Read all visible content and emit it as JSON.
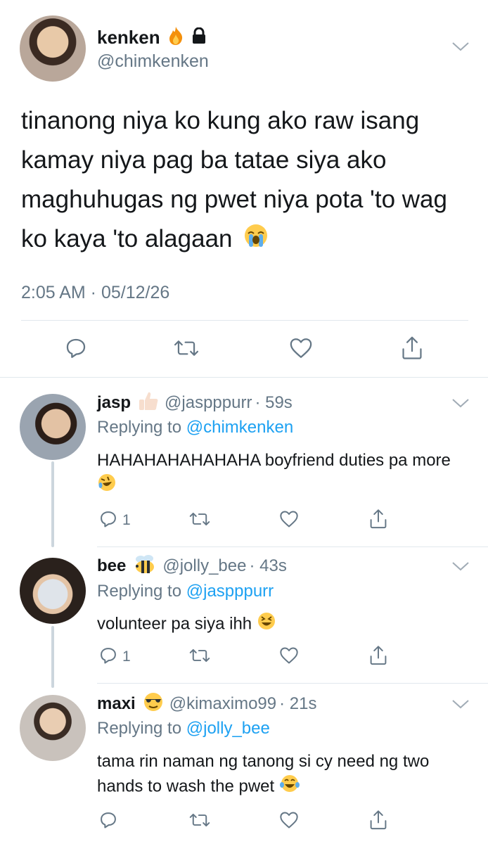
{
  "main_tweet": {
    "display_name": "kenken",
    "handle": "@chimkenken",
    "text": "tinanong niya ko kung ako raw isang kamay niya pag ba tatae siya ako maghuhugas ng pwet niya pota 'to wag ko kaya 'to alagaan",
    "timestamp": "2:05 AM · 05/12/26",
    "name_emojis": [
      "fire-emoji",
      "lock-icon"
    ],
    "text_emoji": "loudly-crying-emoji"
  },
  "replies": [
    {
      "display_name": "jasp",
      "name_emoji": "thumbs-up-emoji",
      "handle": "@jaspppurr",
      "time": "· 59s",
      "replying_label": "Replying to",
      "replying_handle": "@chimkenken",
      "text": "HAHAHAHAHAHAHA boyfriend duties pa more",
      "text_emoji": "rofl-emoji",
      "reply_count": "1"
    },
    {
      "display_name": "bee",
      "name_emoji": "bee-emoji",
      "handle": "@jolly_bee",
      "time": "· 43s",
      "replying_label": "Replying to",
      "replying_handle": "@jaspppurr",
      "text": "volunteer pa siya ihh",
      "text_emoji": "grinning-squinting-emoji",
      "reply_count": "1"
    },
    {
      "display_name": "maxi",
      "name_emoji": "sunglasses-emoji",
      "handle": "@kimaximo99",
      "time": "· 21s",
      "replying_label": "Replying to",
      "replying_handle": "@jolly_bee",
      "text": "tama rin naman ng tanong si cy need ng two hands to wash the pwet",
      "text_emoji": "tears-of-joy-emoji",
      "reply_count": ""
    }
  ],
  "colors": {
    "text": "#14171a",
    "secondary": "#657786",
    "link": "#1da1f2",
    "divider": "#e1e8ed",
    "thread": "#ccd6dd"
  }
}
